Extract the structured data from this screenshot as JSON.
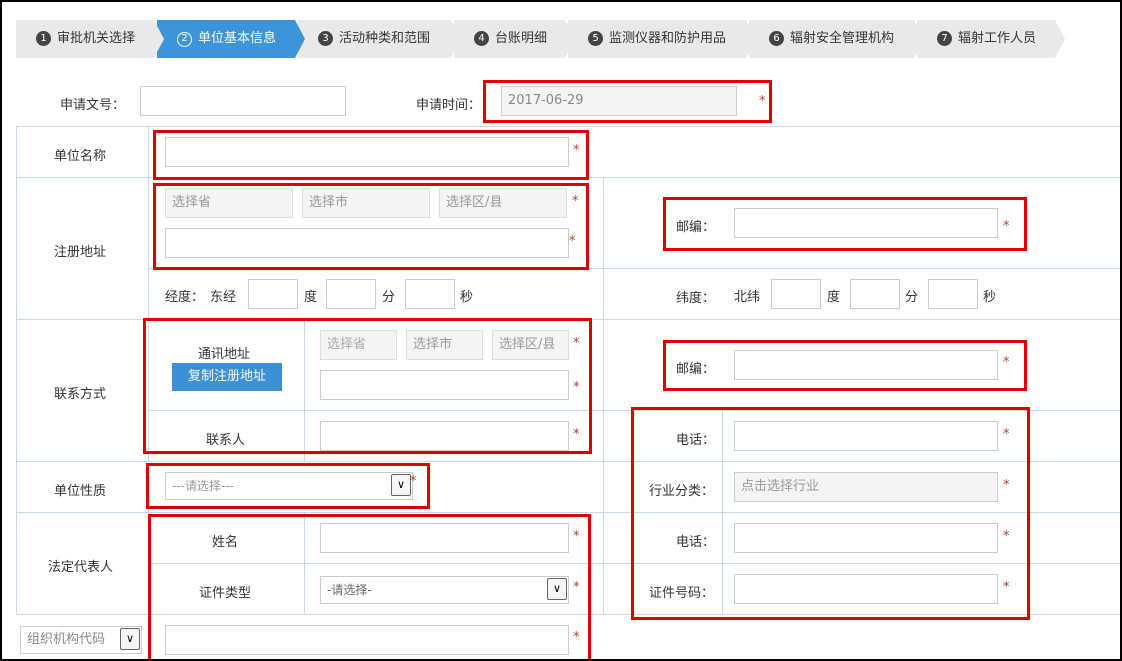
{
  "steps": [
    {
      "num": "1",
      "label": "审批机关选择"
    },
    {
      "num": "2",
      "label": "单位基本信息"
    },
    {
      "num": "3",
      "label": "活动种类和范围"
    },
    {
      "num": "4",
      "label": "台账明细"
    },
    {
      "num": "5",
      "label": "监测仪器和防护用品"
    },
    {
      "num": "6",
      "label": "辐射安全管理机构"
    },
    {
      "num": "7",
      "label": "辐射工作人员"
    }
  ],
  "form": {
    "doc_no_label": "申请文号：",
    "doc_no_value": "",
    "apply_time_label": "申请时间：",
    "apply_time_value": "2017-06-29",
    "unit_name_label": "单位名称",
    "reg_address_label": "注册地址",
    "province_ph": "选择省",
    "city_ph": "选择市",
    "district_ph": "选择区/县",
    "postcode_label": "邮编：",
    "longitude_label": "经度：",
    "longitude_dir": "东经",
    "latitude_label": "纬度：",
    "latitude_dir": "北纬",
    "deg": "度",
    "min": "分",
    "sec": "秒",
    "contact_label": "联系方式",
    "mail_address_label": "通讯地址",
    "copy_reg_button": "复制注册地址",
    "contact_person_label": "联系人",
    "phone_label": "电话：",
    "unit_nature_label": "单位性质",
    "unit_nature_value": "---请选择---",
    "industry_label": "行业分类：",
    "industry_ph": "点击选择行业",
    "legal_rep_label": "法定代表人",
    "name_label": "姓名",
    "id_type_label": "证件类型",
    "id_type_value": "-请选择-",
    "id_no_label": "证件号码：",
    "org_code_value": "组织机构代码",
    "required_mark": "*"
  },
  "colors": {
    "active_tab": "#3d94d8",
    "tab": "#e9e9e9",
    "highlight": "#e00000",
    "required": "#c0392b",
    "grid_line": "#c9d7e6"
  }
}
